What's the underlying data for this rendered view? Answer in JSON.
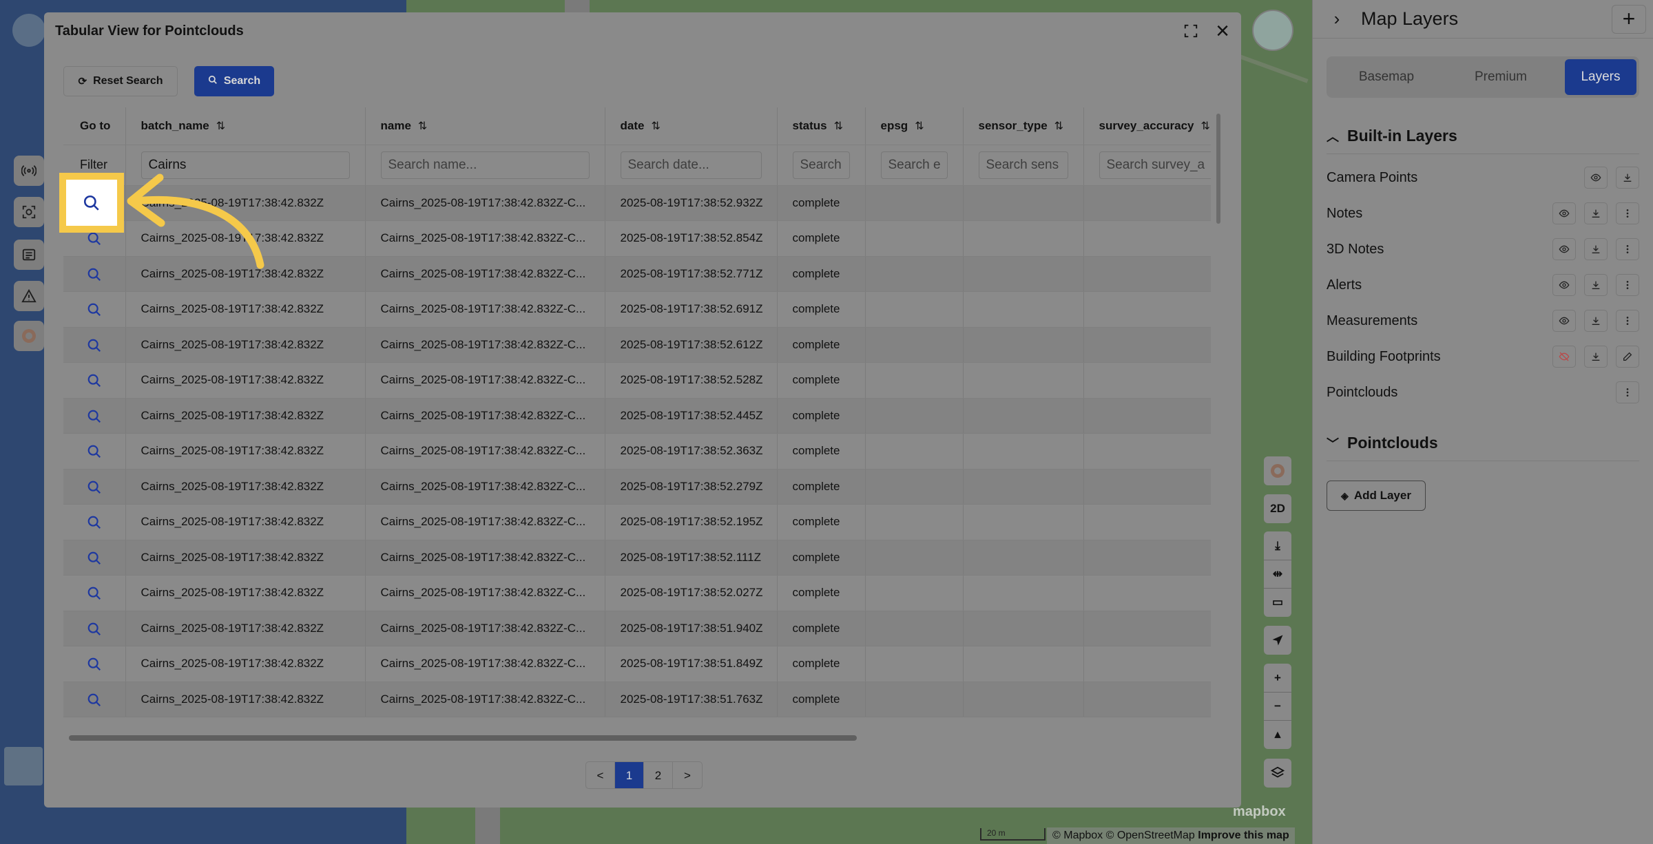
{
  "modal": {
    "title": "Tabular View for Pointclouds",
    "reset_label": "Reset Search",
    "search_label": "Search"
  },
  "table": {
    "columns": [
      {
        "label": "Go to",
        "sortable": false
      },
      {
        "label": "batch_name",
        "sortable": true
      },
      {
        "label": "name",
        "sortable": true
      },
      {
        "label": "date",
        "sortable": true
      },
      {
        "label": "status",
        "sortable": true
      },
      {
        "label": "epsg",
        "sortable": true
      },
      {
        "label": "sensor_type",
        "sortable": true
      },
      {
        "label": "survey_accuracy",
        "sortable": true
      }
    ],
    "filter_label": "Filter",
    "filters": {
      "batch_name": {
        "value": "Cairns",
        "placeholder": ""
      },
      "name": {
        "value": "",
        "placeholder": "Search name..."
      },
      "date": {
        "value": "",
        "placeholder": "Search date..."
      },
      "status": {
        "value": "",
        "placeholder": "Search"
      },
      "epsg": {
        "value": "",
        "placeholder": "Search e"
      },
      "sensor_type": {
        "value": "",
        "placeholder": "Search sens"
      },
      "survey_accuracy": {
        "value": "",
        "placeholder": "Search survey_a"
      }
    },
    "rows": [
      {
        "batch_name": "Cairns_2025-08-19T17:38:42.832Z",
        "name": "Cairns_2025-08-19T17:38:42.832Z-C...",
        "date": "2025-08-19T17:38:52.932Z",
        "status": "complete"
      },
      {
        "batch_name": "Cairns_2025-08-19T17:38:42.832Z",
        "name": "Cairns_2025-08-19T17:38:42.832Z-C...",
        "date": "2025-08-19T17:38:52.854Z",
        "status": "complete"
      },
      {
        "batch_name": "Cairns_2025-08-19T17:38:42.832Z",
        "name": "Cairns_2025-08-19T17:38:42.832Z-C...",
        "date": "2025-08-19T17:38:52.771Z",
        "status": "complete"
      },
      {
        "batch_name": "Cairns_2025-08-19T17:38:42.832Z",
        "name": "Cairns_2025-08-19T17:38:42.832Z-C...",
        "date": "2025-08-19T17:38:52.691Z",
        "status": "complete"
      },
      {
        "batch_name": "Cairns_2025-08-19T17:38:42.832Z",
        "name": "Cairns_2025-08-19T17:38:42.832Z-C...",
        "date": "2025-08-19T17:38:52.612Z",
        "status": "complete"
      },
      {
        "batch_name": "Cairns_2025-08-19T17:38:42.832Z",
        "name": "Cairns_2025-08-19T17:38:42.832Z-C...",
        "date": "2025-08-19T17:38:52.528Z",
        "status": "complete"
      },
      {
        "batch_name": "Cairns_2025-08-19T17:38:42.832Z",
        "name": "Cairns_2025-08-19T17:38:42.832Z-C...",
        "date": "2025-08-19T17:38:52.445Z",
        "status": "complete"
      },
      {
        "batch_name": "Cairns_2025-08-19T17:38:42.832Z",
        "name": "Cairns_2025-08-19T17:38:42.832Z-C...",
        "date": "2025-08-19T17:38:52.363Z",
        "status": "complete"
      },
      {
        "batch_name": "Cairns_2025-08-19T17:38:42.832Z",
        "name": "Cairns_2025-08-19T17:38:42.832Z-C...",
        "date": "2025-08-19T17:38:52.279Z",
        "status": "complete"
      },
      {
        "batch_name": "Cairns_2025-08-19T17:38:42.832Z",
        "name": "Cairns_2025-08-19T17:38:42.832Z-C...",
        "date": "2025-08-19T17:38:52.195Z",
        "status": "complete"
      },
      {
        "batch_name": "Cairns_2025-08-19T17:38:42.832Z",
        "name": "Cairns_2025-08-19T17:38:42.832Z-C...",
        "date": "2025-08-19T17:38:52.111Z",
        "status": "complete"
      },
      {
        "batch_name": "Cairns_2025-08-19T17:38:42.832Z",
        "name": "Cairns_2025-08-19T17:38:42.832Z-C...",
        "date": "2025-08-19T17:38:52.027Z",
        "status": "complete"
      },
      {
        "batch_name": "Cairns_2025-08-19T17:38:42.832Z",
        "name": "Cairns_2025-08-19T17:38:42.832Z-C...",
        "date": "2025-08-19T17:38:51.940Z",
        "status": "complete"
      },
      {
        "batch_name": "Cairns_2025-08-19T17:38:42.832Z",
        "name": "Cairns_2025-08-19T17:38:42.832Z-C...",
        "date": "2025-08-19T17:38:51.849Z",
        "status": "complete"
      },
      {
        "batch_name": "Cairns_2025-08-19T17:38:42.832Z",
        "name": "Cairns_2025-08-19T17:38:42.832Z-C...",
        "date": "2025-08-19T17:38:51.763Z",
        "status": "complete"
      }
    ]
  },
  "pagination": {
    "prev": "<",
    "next": ">",
    "pages": [
      "1",
      "2"
    ],
    "current": "1"
  },
  "panel": {
    "title": "Map Layers",
    "tabs": [
      {
        "label": "Basemap",
        "active": false
      },
      {
        "label": "Premium",
        "active": false
      },
      {
        "label": "Layers",
        "active": true
      }
    ],
    "builtin_title": "Built-in Layers",
    "builtin_layers": [
      {
        "label": "Camera Points",
        "actions": [
          "eye-icon",
          "download-icon"
        ]
      },
      {
        "label": "Notes",
        "actions": [
          "eye-icon",
          "download-icon",
          "more-icon"
        ]
      },
      {
        "label": "3D Notes",
        "actions": [
          "eye-icon",
          "download-icon",
          "more-icon"
        ]
      },
      {
        "label": "Alerts",
        "actions": [
          "eye-icon",
          "download-icon",
          "more-icon"
        ]
      },
      {
        "label": "Measurements",
        "actions": [
          "eye-icon",
          "download-icon",
          "more-icon"
        ]
      },
      {
        "label": "Building Footprints",
        "actions": [
          "eye-off-icon",
          "download-icon",
          "edit-icon"
        ]
      },
      {
        "label": "Pointclouds",
        "actions": [
          "more-icon"
        ]
      }
    ],
    "pointclouds_title": "Pointclouds",
    "add_layer_label": "Add Layer"
  },
  "map": {
    "view_mode": "2D",
    "scale_label": "20 m",
    "attribution": "© Mapbox © OpenStreetMap",
    "improve_link": "Improve this map",
    "wordmark": "mapbox"
  },
  "colors": {
    "accent": "#1b3a8e",
    "highlight": "#f5c94a",
    "goto_icon": "#1e38a0"
  }
}
